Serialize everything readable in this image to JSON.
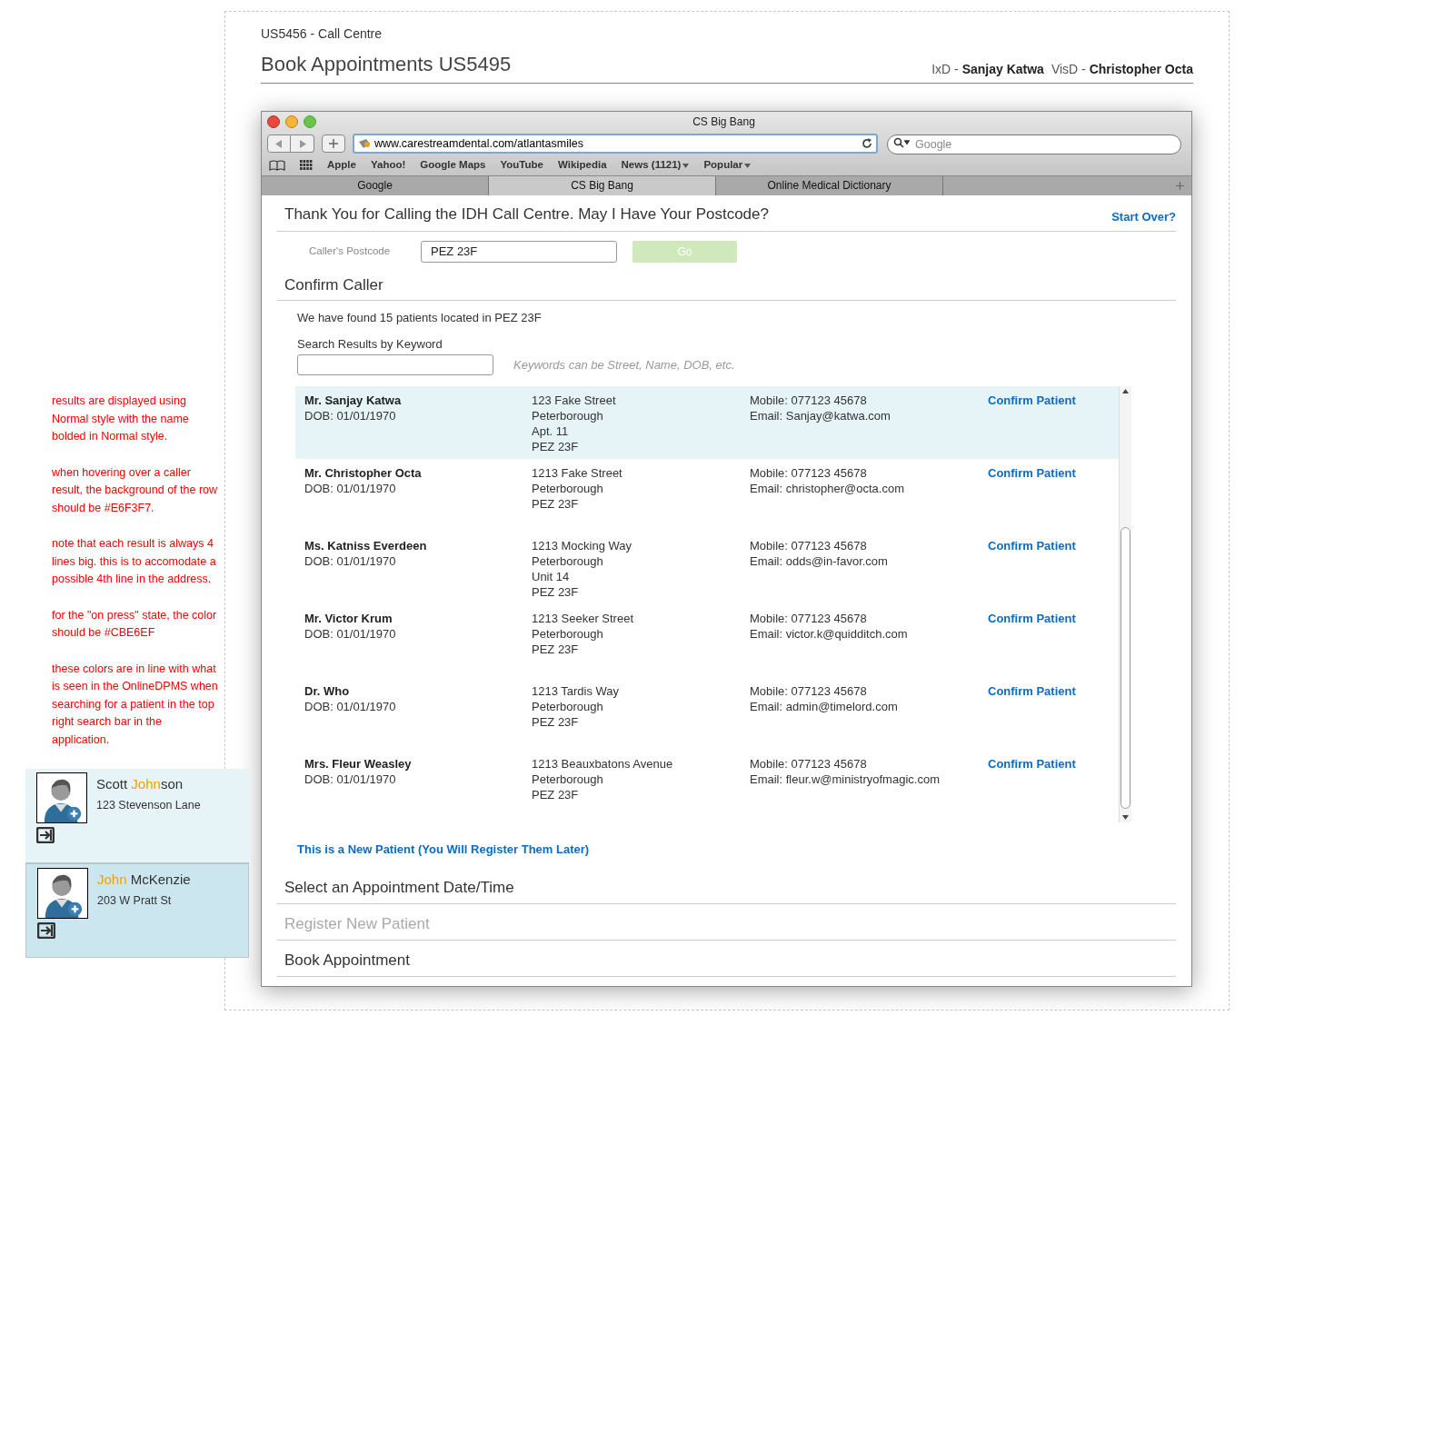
{
  "header": {
    "project": "US5456 - Call Centre",
    "title": "Book Appointments US5495",
    "credits": [
      {
        "role": "IxD - ",
        "name": "Sanjay Katwa"
      },
      {
        "role": "VisD - ",
        "name": "Christopher Octa"
      }
    ]
  },
  "annotations": [
    "results are displayed using Normal style with the name bolded in Normal style.",
    "when hovering over a caller result, the background of the row should be #E6F3F7.",
    "note that each result is always 4 lines big. this is to accomodate a possible 4th line in the address.",
    "for the \"on press\" state, the color should be #CBE6EF",
    "these colors are in line with what is seen in the OnlineDPMS when searching for a patient in the top right search bar in the application."
  ],
  "sample_cards": [
    {
      "pressed": false,
      "name": [
        {
          "text": "Scott ",
          "match": false
        },
        {
          "text": "John",
          "match": true
        },
        {
          "text": "son",
          "match": false
        }
      ],
      "address": "123 Stevenson Lane"
    },
    {
      "pressed": true,
      "name": [
        {
          "text": "John",
          "match": true
        },
        {
          "text": " McKenzie",
          "match": false
        }
      ],
      "address": "203 W Pratt St"
    }
  ],
  "browser": {
    "title": "CS Big Bang",
    "url": "www.carestreamdental.com/atlantasmiles",
    "search_placeholder": "Google",
    "bookmarks": [
      {
        "label": "Apple",
        "menu": false
      },
      {
        "label": "Yahoo!",
        "menu": false
      },
      {
        "label": "Google Maps",
        "menu": false
      },
      {
        "label": "YouTube",
        "menu": false
      },
      {
        "label": "Wikipedia",
        "menu": false
      },
      {
        "label": "News (1121)",
        "menu": true
      },
      {
        "label": "Popular",
        "menu": true
      }
    ],
    "tabs": [
      {
        "label": "Google",
        "selected": false
      },
      {
        "label": "CS Big Bang",
        "selected": true
      },
      {
        "label": "Online Medical Dictionary",
        "selected": false
      }
    ]
  },
  "page": {
    "heading": "Thank You for Calling the IDH Call Centre. May I Have Your Postcode?",
    "start_over": "Start Over?",
    "postcode_label": "Caller's Postcode",
    "postcode_value": "PEZ 23F",
    "go_button": {
      "label": "Go",
      "disabled": true
    },
    "confirm_heading": "Confirm Caller",
    "found_text": "We have found 15 patients located in PEZ 23F",
    "search_label": "Search Results by Keyword",
    "search_hint": "Keywords can be Street, Name, DOB, etc.",
    "results": [
      {
        "name": "Mr. Sanjay Katwa",
        "dob": "DOB: 01/01/1970",
        "address": [
          "123 Fake Street",
          "Peterborough",
          "Apt. 11",
          "PEZ 23F"
        ],
        "mobile": "Mobile: 077123 45678",
        "email": "Email: Sanjay@katwa.com",
        "action": "Confirm Patient",
        "hovered": true
      },
      {
        "name": "Mr. Christopher Octa",
        "dob": "DOB: 01/01/1970",
        "address": [
          "1213 Fake Street",
          "Peterborough",
          "PEZ 23F"
        ],
        "mobile": "Mobile: 077123 45678",
        "email": "Email: christopher@octa.com",
        "action": "Confirm Patient",
        "hovered": false
      },
      {
        "name": "Ms. Katniss Everdeen",
        "dob": "DOB: 01/01/1970",
        "address": [
          "1213 Mocking Way",
          "Peterborough",
          "Unit 14",
          "PEZ 23F"
        ],
        "mobile": "Mobile: 077123 45678",
        "email": "Email: odds@in-favor.com",
        "action": "Confirm Patient",
        "hovered": false
      },
      {
        "name": "Mr. Victor Krum",
        "dob": "DOB: 01/01/1970",
        "address": [
          "1213 Seeker Street",
          "Peterborough",
          "PEZ 23F"
        ],
        "mobile": "Mobile: 077123 45678",
        "email": "Email: victor.k@quidditch.com",
        "action": "Confirm Patient",
        "hovered": false
      },
      {
        "name": "Dr. Who",
        "dob": "DOB: 01/01/1970",
        "address": [
          "1213 Tardis Way",
          "Peterborough",
          "PEZ 23F"
        ],
        "mobile": "Mobile: 077123 45678",
        "email": "Email: admin@timelord.com",
        "action": "Confirm Patient",
        "hovered": false
      },
      {
        "name": "Mrs. Fleur Weasley",
        "dob": "DOB: 01/01/1970",
        "address": [
          "1213 Beauxbatons Avenue",
          "Peterborough",
          "PEZ 23F"
        ],
        "mobile": "Mobile: 077123 45678",
        "email": "Email: fleur.w@ministryofmagic.com",
        "action": "Confirm Patient",
        "hovered": false
      }
    ],
    "new_patient_link": "This is a New Patient (You Will Register Them Later)",
    "steps": [
      {
        "label": "Select an Appointment Date/Time",
        "disabled": false
      },
      {
        "label": "Register New Patient",
        "disabled": true
      },
      {
        "label": "Book Appointment",
        "disabled": false
      }
    ]
  }
}
